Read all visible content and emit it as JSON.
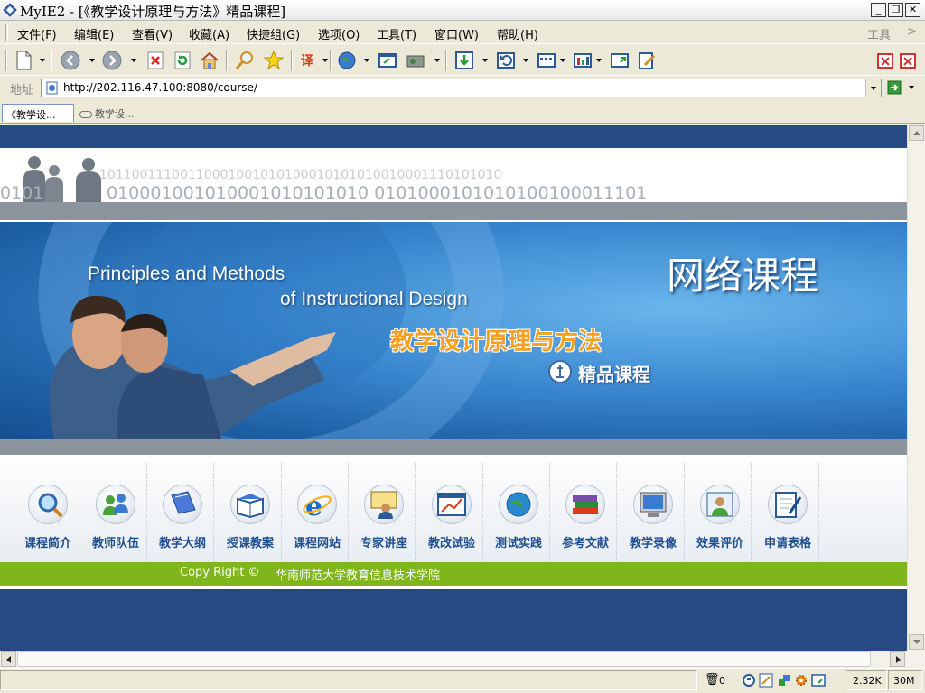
{
  "window": {
    "title": "MyIE2 - [《教学设计原理与方法》精品课程]",
    "app_icon": "myie2-diamond-icon",
    "controls": [
      "minimize",
      "restore",
      "close"
    ]
  },
  "menu": {
    "items": [
      "文件(F)",
      "编辑(E)",
      "查看(V)",
      "收藏(A)",
      "快捷组(G)",
      "选项(O)",
      "工具(T)",
      "窗口(W)",
      "帮助(H)"
    ],
    "right_label": "工具",
    "right_chevron": ">"
  },
  "toolbar": {
    "buttons": [
      "new-window-icon",
      "back-icon",
      "forward-icon",
      "stop-icon",
      "refresh-icon",
      "home-icon",
      "search-icon",
      "favorites-star-icon",
      "translate-icon",
      "globe-icon",
      "open-window-icon",
      "proxy-icon",
      "download-icon",
      "undo-icon",
      "layout-icon",
      "filter-icon",
      "fullscreen-icon",
      "edit-icon",
      "close-all-icon",
      "close-icon"
    ]
  },
  "address": {
    "label": "地址",
    "url": "http://202.116.47.100:8080/course/"
  },
  "tabs": [
    {
      "label": "《教学设...",
      "active": true
    },
    {
      "label": "教学设...",
      "active": false
    }
  ],
  "page": {
    "binary_lines": [
      "10110011100110001001010100010101010010001110101010",
      "010001001010001010101010 0101000101010100100011101",
      "0101"
    ],
    "banner_en_line1": "Principles and Methods",
    "banner_en_line2": "of Instructional Design",
    "banner_cn_title": "教学设计原理与方法",
    "banner_quality": "精品课程",
    "banner_big": "网络课程",
    "nav": [
      {
        "label": "课程简介",
        "icon": "magnifier-book-icon"
      },
      {
        "label": "教师队伍",
        "icon": "people-icon"
      },
      {
        "label": "教学大纲",
        "icon": "book-icon"
      },
      {
        "label": "授课教案",
        "icon": "open-book-icon"
      },
      {
        "label": "课程网站",
        "icon": "ie-e-icon"
      },
      {
        "label": "专家讲座",
        "icon": "lecturer-icon"
      },
      {
        "label": "教改试验",
        "icon": "chart-window-icon"
      },
      {
        "label": "测试实践",
        "icon": "globe-test-icon"
      },
      {
        "label": "参考文献",
        "icon": "book-stack-icon"
      },
      {
        "label": "教学录像",
        "icon": "computer-monitor-icon"
      },
      {
        "label": "效果评价",
        "icon": "user-evaluation-icon"
      },
      {
        "label": "申请表格",
        "icon": "pen-form-icon"
      }
    ],
    "copyright_label": "Copy Right ©",
    "copyright_org": "华南师范大学教育信息技术学院"
  },
  "status": {
    "trash_count": "0",
    "speed": "2.32K",
    "memory": "30M"
  },
  "colors": {
    "navy": "#264a84",
    "banner_blue": "#3a87cf",
    "orange_title": "#f5a020",
    "green_bar": "#7fb61b",
    "nav_text": "#1f4f91"
  }
}
